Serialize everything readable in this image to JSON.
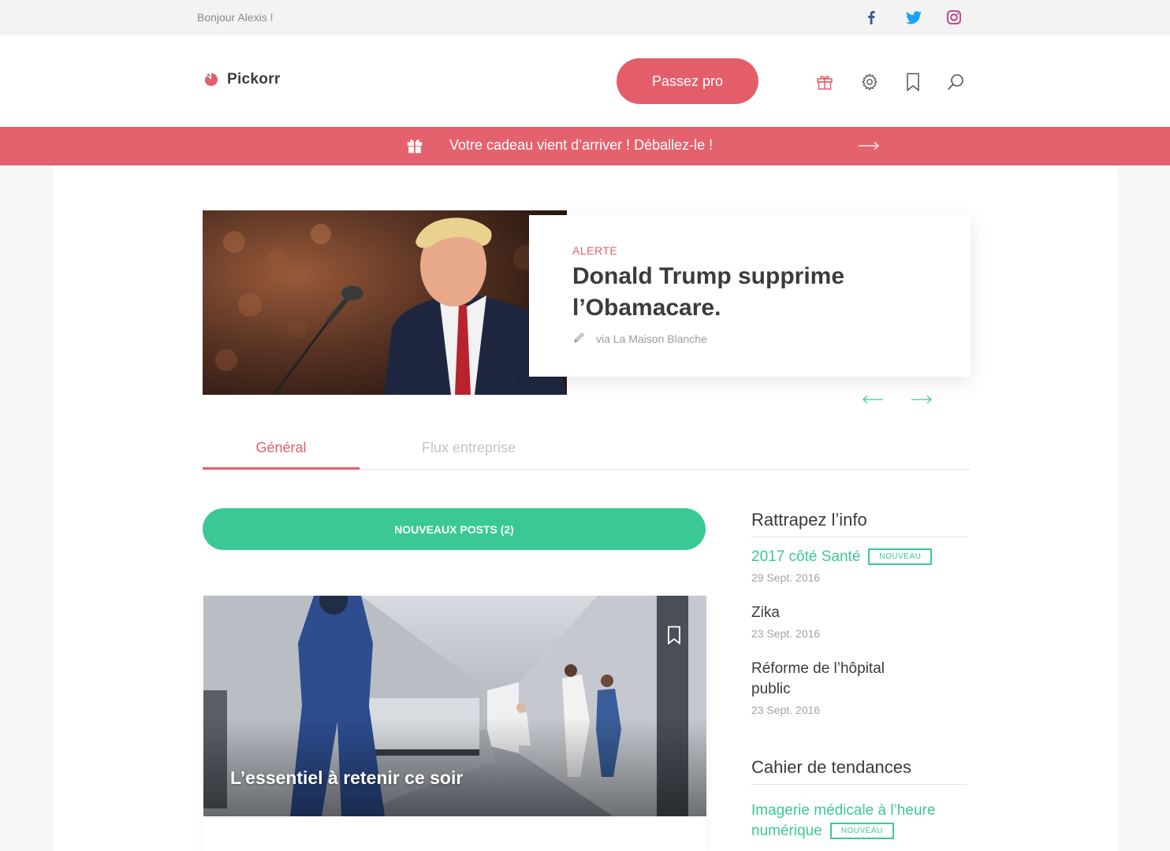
{
  "topbar": {
    "greeting": "Bonjour Alexis !",
    "social": [
      {
        "name": "facebook-icon",
        "color": "#3b5998"
      },
      {
        "name": "twitter-icon",
        "color": "#1da1f2"
      },
      {
        "name": "instagram-icon",
        "color": "#c13584"
      }
    ]
  },
  "header": {
    "brand": "Pickorr",
    "pro_label": "Passez pro",
    "icons": [
      "gift-icon",
      "gear-icon",
      "bookmark-icon",
      "search-icon"
    ]
  },
  "banner": {
    "text": "Votre cadeau vient d’arriver ! Déballez-le !"
  },
  "hero": {
    "tag": "ALERTE",
    "title": "Donald Trump supprime l’Obamacare.",
    "source": "via La Maison Blanche"
  },
  "tabs": [
    {
      "label": "Général",
      "active": true
    },
    {
      "label": "Flux entreprise",
      "active": false
    }
  ],
  "feed": {
    "new_posts_label": "NOUVEAUX POSTS (2)",
    "article_title": "L’essentiel à retenir ce soir"
  },
  "sidebar": {
    "catchup_heading": "Rattrapez l’info",
    "catchup_items": [
      {
        "title": "2017 côté Santé",
        "date": "29 Sept. 2016",
        "badge": "NOUVEAU"
      },
      {
        "title": "Zika",
        "date": "23 Sept. 2016"
      },
      {
        "title": "Réforme de l’hôpital public",
        "date": "23 Sept. 2016"
      }
    ],
    "trends_heading": "Cahier de tendances",
    "trends_items": [
      {
        "title": "Imagerie médicale à l’heure numérique",
        "badge": "NOUVEAU"
      }
    ]
  },
  "colors": {
    "accent": "#e45d6b",
    "green": "#3ac994"
  }
}
